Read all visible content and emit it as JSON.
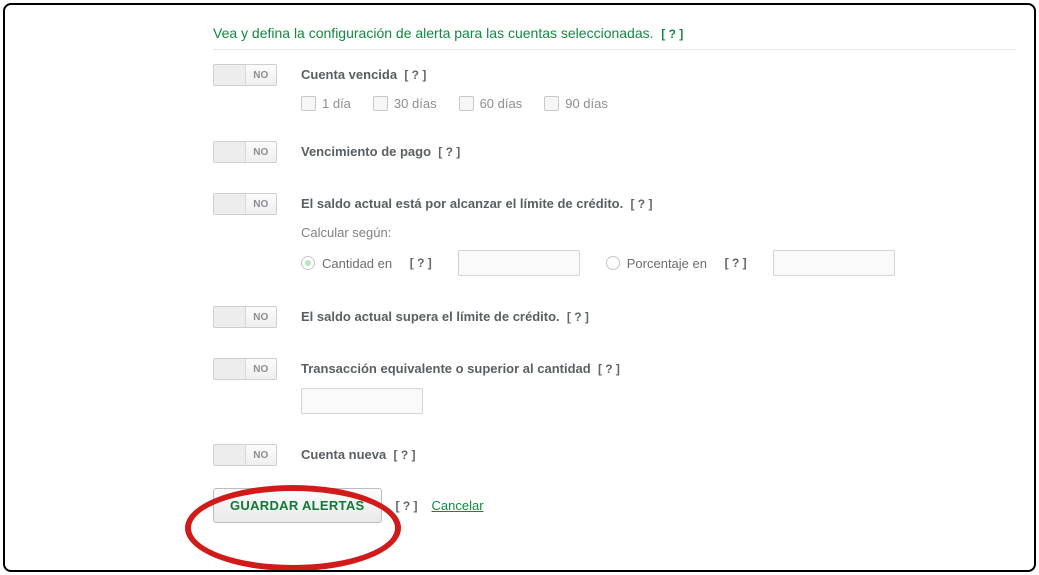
{
  "header": {
    "title": "Vea y defina la configuración de alerta para las cuentas seleccionadas.",
    "help": "[ ? ]"
  },
  "toggle_label": "NO",
  "help": "[ ? ]",
  "alerts": {
    "past_due": {
      "title": "Cuenta vencida",
      "options": [
        "1 día",
        "30 días",
        "60 días",
        "90 días"
      ]
    },
    "payment_due": {
      "title": "Vencimiento de pago"
    },
    "reach_limit": {
      "title": "El saldo actual está por alcanzar el límite de crédito.",
      "calc_label": "Calcular según:",
      "amount_label": "Cantidad en",
      "percent_label": "Porcentaje en"
    },
    "exceed_limit": {
      "title": "El saldo actual supera el límite de crédito."
    },
    "transaction_ge": {
      "title": "Transacción equivalente o superior al cantidad"
    },
    "new_account": {
      "title": "Cuenta nueva"
    }
  },
  "actions": {
    "save": "GUARDAR ALERTAS",
    "cancel": "Cancelar"
  }
}
